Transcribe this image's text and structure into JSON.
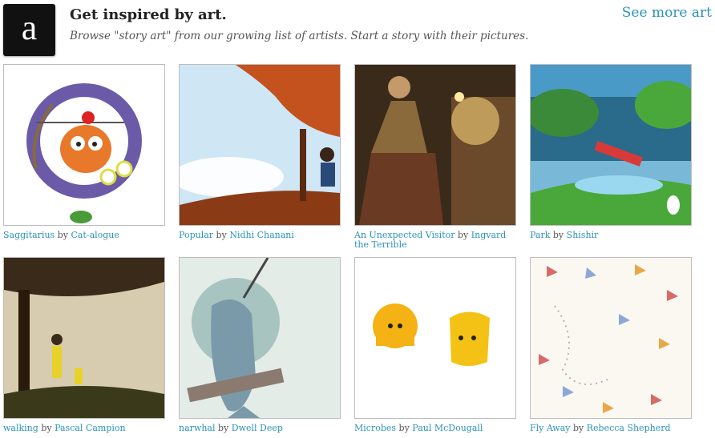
{
  "header": {
    "logo_letter": "a",
    "title": "Get inspired by art.",
    "subtitle": "Browse \"story art\" from our growing list of artists. Start a story with their pictures.",
    "see_more": "See more art"
  },
  "by_word": "by",
  "tiles": [
    {
      "title": "Saggitarius",
      "artist": "Cat-alogue"
    },
    {
      "title": "Popular",
      "artist": "Nidhi Chanani"
    },
    {
      "title": "An Unexpected Visitor",
      "artist": "Ingvard the Terrible"
    },
    {
      "title": "Park",
      "artist": "Shishir"
    },
    {
      "title": "walking",
      "artist": "Pascal Campion"
    },
    {
      "title": "narwhal",
      "artist": "Dwell Deep"
    },
    {
      "title": "Microbes",
      "artist": "Paul McDougall"
    },
    {
      "title": "Fly Away",
      "artist": "Rebecca Shepherd"
    }
  ],
  "colors": {
    "link": "#2b93b8",
    "logo_bg": "#111111"
  }
}
